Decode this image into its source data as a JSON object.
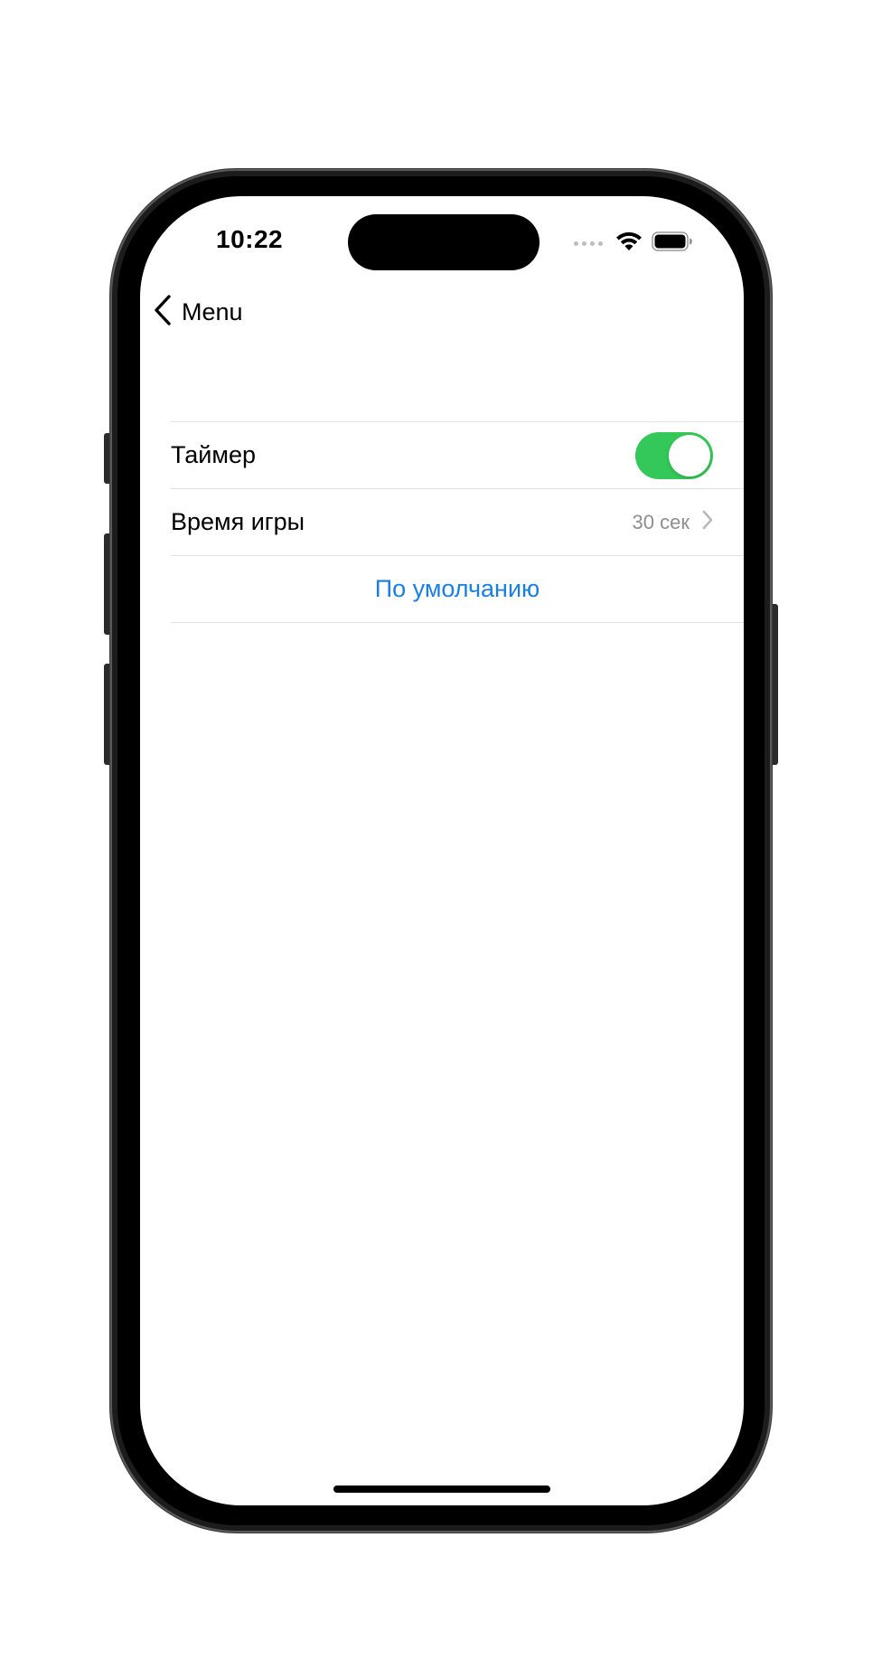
{
  "status_bar": {
    "time": "10:22",
    "wifi_icon": "wifi-icon",
    "battery_icon": "battery-icon"
  },
  "nav": {
    "back_label": "Menu",
    "back_icon": "chevron-left-icon"
  },
  "settings": {
    "timer": {
      "label": "Таймер",
      "enabled": true
    },
    "game_time": {
      "label": "Время игры",
      "value": "30 сек",
      "icon": "chevron-right-icon"
    },
    "default_button": {
      "label": "По умолчанию"
    }
  },
  "colors": {
    "accent": "#1a7fe0",
    "toggle_on": "#34c759",
    "secondary_text": "#8e8e93",
    "divider": "#e2e2e4"
  }
}
